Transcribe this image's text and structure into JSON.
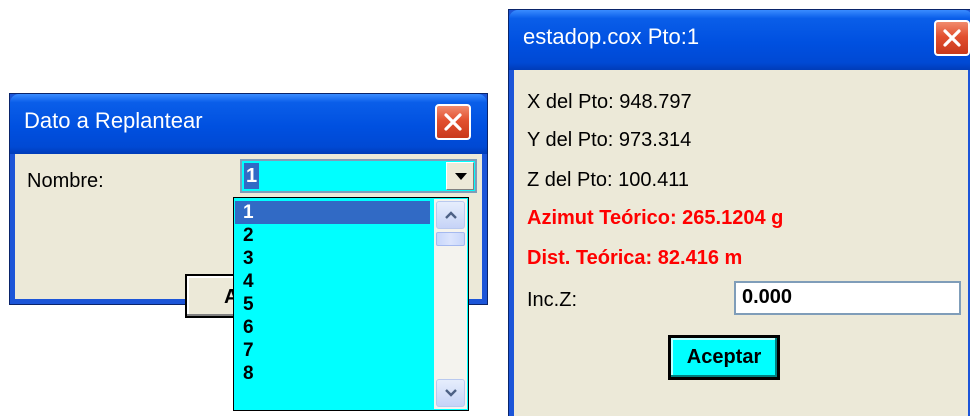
{
  "dialog_left": {
    "title": "Dato a Replantear",
    "name_label": "Nombre:",
    "selected_value": "1",
    "button_label_visible": "Ac",
    "options": [
      "1",
      "2",
      "3",
      "4",
      "5",
      "6",
      "7",
      "8"
    ]
  },
  "dialog_right": {
    "title": "estadop.cox Pto:1",
    "x_line": "X del Pto:  948.797",
    "y_line": "Y del Pto:  973.314",
    "z_line": "Z del Pto:  100.411",
    "azimut_line": "Azimut Teórico:  265.1204 g",
    "dist_line": "Dist. Teórica:  82.416 m",
    "inc_label": "Inc.Z:",
    "inc_value": "0.000",
    "accept_label": "Aceptar"
  },
  "colors": {
    "title_blue": "#0050e0",
    "dialog_bg": "#ece9d8",
    "highlight": "#00ffff",
    "selection": "#316ac5",
    "emphasis_red": "#ff0000",
    "close_red": "#e2502f"
  },
  "icons": {
    "close": "close-icon",
    "dropdown": "chevron-down-icon",
    "scroll_up": "chevron-up-icon",
    "scroll_down": "chevron-down-icon"
  }
}
